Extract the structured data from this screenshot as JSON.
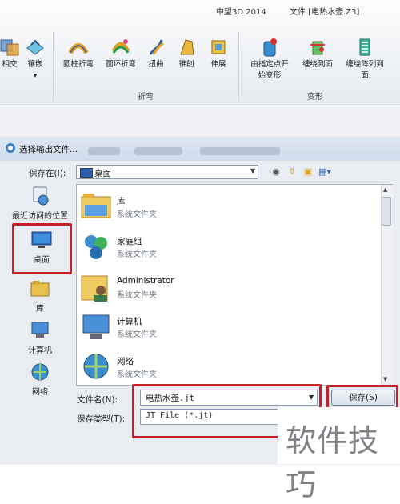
{
  "app": {
    "title": "中望3D 2014",
    "document": "文件 [电热水壶.Z3]"
  },
  "ribbon": {
    "buttons": [
      {
        "id": "intersect",
        "label": "相交"
      },
      {
        "id": "emboss",
        "label": "镶嵌"
      },
      {
        "id": "cyl-bend",
        "label": "圆柱折弯"
      },
      {
        "id": "ring-bend",
        "label": "圆环折弯"
      },
      {
        "id": "twist",
        "label": "扭曲"
      },
      {
        "id": "taper",
        "label": "锥削"
      },
      {
        "id": "stretch",
        "label": "伸展"
      },
      {
        "id": "point-deform",
        "label": "由指定点开始变形"
      },
      {
        "id": "wrap-face",
        "label": "缠绕到面"
      },
      {
        "id": "wrap-array",
        "label": "缠绕阵列到面"
      }
    ],
    "groups": {
      "bend": "折弯",
      "deform": "变形"
    }
  },
  "dialog": {
    "title": "选择输出文件...",
    "save_in_label": "保存在(I):",
    "save_in_value": "桌面",
    "places": [
      {
        "label": "最近访问的位置",
        "icon": "recent-places-icon"
      },
      {
        "label": "桌面",
        "icon": "desktop-icon"
      },
      {
        "label": "库",
        "icon": "libraries-icon"
      },
      {
        "label": "计算机",
        "icon": "computer-icon"
      },
      {
        "label": "网络",
        "icon": "network-icon"
      }
    ],
    "files": [
      {
        "name": "库",
        "type": "系统文件夹",
        "icon": "libraries-folder-icon"
      },
      {
        "name": "家庭组",
        "type": "系统文件夹",
        "icon": "homegroup-icon"
      },
      {
        "name": "Administrator",
        "type": "系统文件夹",
        "icon": "user-folder-icon"
      },
      {
        "name": "计算机",
        "type": "系统文件夹",
        "icon": "computer-icon"
      },
      {
        "name": "网络",
        "type": "系统文件夹",
        "icon": "network-icon"
      }
    ],
    "filename_label": "文件名(N):",
    "filename_value": "电热水壶.jt",
    "filetype_label": "保存类型(T):",
    "filetype_value": "JT File (*.jt)",
    "save_button": "保存(S)"
  },
  "watermark": "软件技巧",
  "colors": {
    "highlight": "#c8202a",
    "ribbon_bg": "#eef1f5",
    "dialog_bg": "#e9edf2"
  }
}
